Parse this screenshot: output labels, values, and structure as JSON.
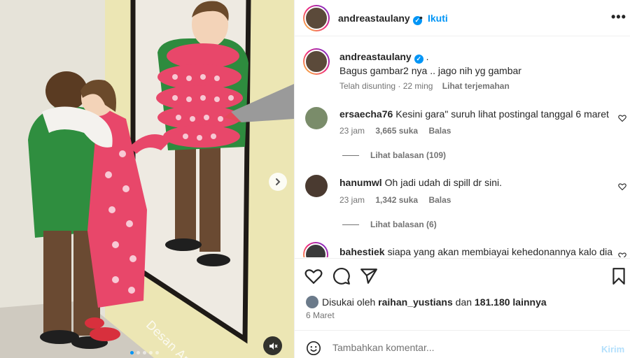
{
  "post": {
    "username": "andreastaulany",
    "follow_label": "Ikuti",
    "dot_separator": "•",
    "more_icon": "more-horizontal-icon",
    "verified_icon": "verified-badge-icon"
  },
  "media": {
    "watermark": "Desan Art",
    "slide_count": 5,
    "active_slide": 1,
    "next_icon": "chevron-right-icon",
    "mute_icon": "speaker-muted-icon"
  },
  "caption": {
    "username": "andreastaulany",
    "suffix": ".",
    "text": "Bagus gambar2 nya .. jago nih yg gambar",
    "edited": "Telah disunting",
    "time": "22 ming",
    "translate": "Lihat terjemahan"
  },
  "comments": [
    {
      "username": "ersaecha76",
      "text": "Kesini gara\" suruh lihat postingal tanggal 6 maret",
      "time": "23 jam",
      "likes": "3,665 suka",
      "reply": "Balas",
      "view_replies": "Lihat balasan (109)"
    },
    {
      "username": "hanumwl",
      "text": "Oh jadi udah di spill dr sini.",
      "time": "23 jam",
      "likes": "1,342 suka",
      "reply": "Balas",
      "view_replies": "Lihat balasan (6)"
    },
    {
      "username": "bahestiek",
      "text": "siapa yang akan membiayai kehedonannya kalo dia"
    }
  ],
  "actions": {
    "like_icon": "heart-icon",
    "comment_icon": "comment-icon",
    "share_icon": "send-icon",
    "save_icon": "bookmark-icon"
  },
  "likes": {
    "prefix": "Disukai oleh",
    "user": "raihan_yustians",
    "conj": "dan",
    "others": "181.180 lainnya"
  },
  "date": "6 Maret",
  "composer": {
    "placeholder": "Tambahkan komentar...",
    "post_label": "Kirim",
    "emoji_icon": "emoji-icon"
  },
  "colors": {
    "accent": "#0095f6",
    "muted": "#737373",
    "text": "#262626",
    "post_disabled": "#b2dffc"
  }
}
